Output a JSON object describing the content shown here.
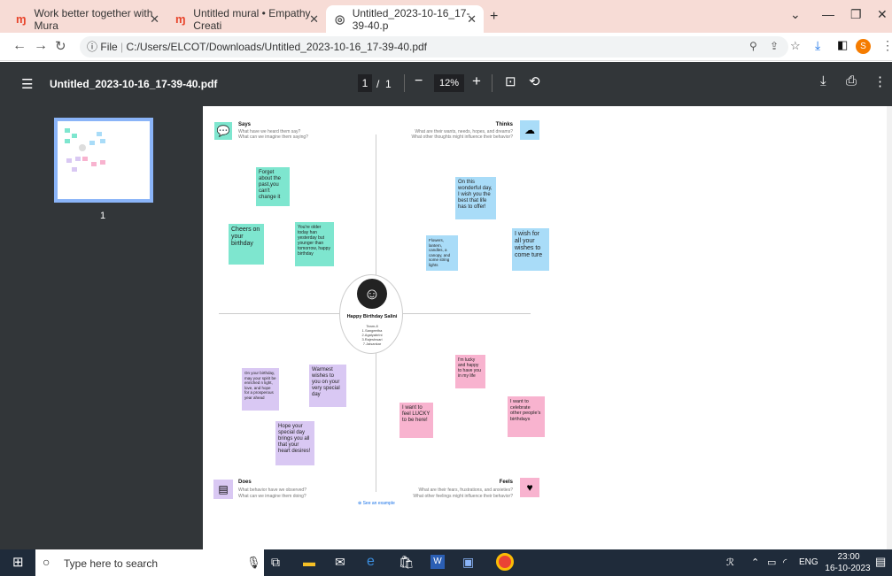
{
  "browser": {
    "tabs": [
      {
        "label": "Work better together with Mura"
      },
      {
        "label": "Untitled mural • Empathy Creati"
      },
      {
        "label": "Untitled_2023-10-16_17-39-40.p"
      }
    ],
    "new_tab": "+",
    "addr": {
      "prefix": "File",
      "url": "C:/Users/ELCOT/Downloads/Untitled_2023-10-16_17-39-40.pdf"
    },
    "profile_initial": "S"
  },
  "pdf": {
    "title": "Untitled_2023-10-16_17-39-40.pdf",
    "page": "1",
    "page_sep": "/",
    "page_total": "1",
    "zoom": "12%",
    "thumb_label": "1"
  },
  "canvas": {
    "says": {
      "title": "Says",
      "q1": "What have we heard them say?",
      "q2": "What can we imagine them saying?"
    },
    "thinks": {
      "title": "Thinks",
      "q1": "What are their wants, needs, hopes, and dreams?",
      "q2": "What other thoughts might influence their behavior?"
    },
    "does": {
      "title": "Does",
      "q1": "What behavior have we observed?",
      "q2": "What can we imagine them doing?"
    },
    "feels": {
      "title": "Feels",
      "q1": "What are their fears, frustrations, and anxieties?",
      "q2": "What other feelings might influence their behavior?"
    },
    "center": {
      "name": "Happy Birthday Salini",
      "team": [
        "Team-8",
        "1.Sangeetha",
        "2.Agalyabrini",
        "3.Rajeshwari",
        "7.Jaisankar"
      ]
    },
    "see_example": "See an example",
    "notes": {
      "n1": "Forget about the past,you can't change it",
      "n2": "Cheers on your birthday",
      "n3": "You're older today han yesterday but younger than tomorrow, happy birthday",
      "n4": "On this wonderful day, I wish you the best that life has to offer!",
      "n5": "Flowers, lantern, candles, a canopy, and some string lights",
      "n6": "I wish  for all your wishes to come ture",
      "n7": "On your birthday, may your spirit be enriched n light, love, and hope for a prosperous year ahead",
      "n8": "Warmest wishes to you on your very special day",
      "n9": "Hope your special day brings you all that your heart desires!",
      "n10": "I'm lucky and happy to have you in my life",
      "n11": "I want to feel LUCKY to be here!",
      "n12": "I want to celebrate other people's birthdays"
    }
  },
  "taskbar": {
    "search": "Type here to search",
    "lang": "ENG",
    "time": "23:00",
    "date": "16-10-2023"
  }
}
